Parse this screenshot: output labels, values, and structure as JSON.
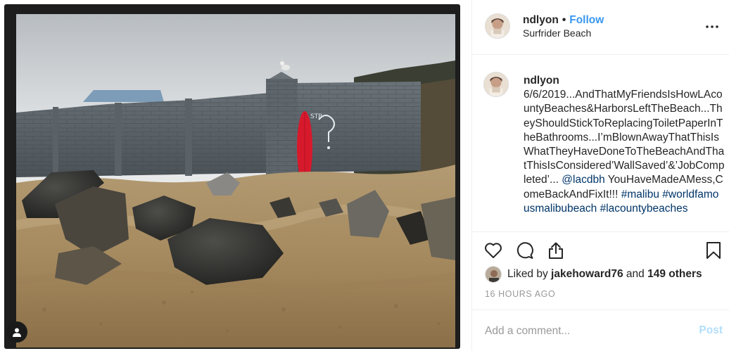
{
  "post": {
    "username": "ndlyon",
    "separator": "•",
    "follow_label": "Follow",
    "location": "Surfrider Beach",
    "caption": {
      "text": "6/6/2019...AndThatMyFriendsIsHowLAcountyBeaches&HarborsLeftTheBeach...TheyShouldStickToReplacingToiletPaperInTheBathrooms...I’mBlownAwayThatThisIsWhatTheyHaveDoneToTheBeachAndThatThisIsConsidered’WallSaved’&’JobCompleted’... ",
      "mention": "@lacdbh",
      "text_after": " YouHaveMadeAMess,ComeBackAndFixIt!!! ",
      "hashtag_1": "#malibu",
      "hashtag_2": "#worldfamousmalibubeach",
      "hashtag_3": "#lacountybeaches"
    },
    "likes": {
      "prefix": "Liked by ",
      "user": "jakehoward76",
      "middle": " and ",
      "others": "149 others"
    },
    "timestamp": "16 HOURS AGO",
    "comment_placeholder": "Add a comment...",
    "post_label": "Post"
  },
  "icons": {
    "more": "more-options-icon",
    "like": "heart-icon",
    "comment": "comment-icon",
    "share": "share-icon",
    "save": "bookmark-icon",
    "tagged_users": "user-tag-icon"
  },
  "colors": {
    "link": "#003569",
    "follow": "#3897f0",
    "post_disabled": "#b2dffc",
    "muted": "#999999",
    "surfboard": "#d7192c"
  }
}
